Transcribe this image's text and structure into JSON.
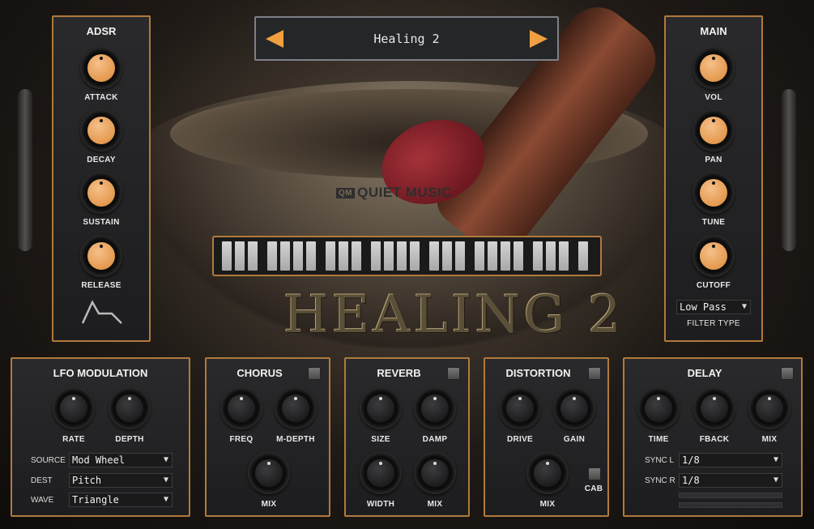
{
  "preset": {
    "name": "Healing 2",
    "prev_icon": "left-triangle-icon",
    "next_icon": "right-triangle-icon"
  },
  "brand": {
    "logo_mark": "QM",
    "logo_text": "QUIET MUSIC",
    "title_art": "HEALING 2"
  },
  "adsr": {
    "title": "ADSR",
    "knobs": [
      "ATTACK",
      "DECAY",
      "SUSTAIN",
      "RELEASE"
    ],
    "envelope_icon": "envelope-shape-icon"
  },
  "main": {
    "title": "MAIN",
    "knobs": [
      "VOL",
      "PAN",
      "TUNE",
      "CUTOFF"
    ],
    "filter_type_label": "FILTER TYPE",
    "filter_type_value": "Low Pass"
  },
  "lfo": {
    "title": "LFO MODULATION",
    "knobs": [
      "RATE",
      "DEPTH"
    ],
    "source_label": "SOURCE",
    "source_value": "Mod Wheel",
    "dest_label": "DEST",
    "dest_value": "Pitch",
    "wave_label": "WAVE",
    "wave_value": "Triangle"
  },
  "chorus": {
    "title": "CHORUS",
    "knobs": [
      "FREQ",
      "M-DEPTH",
      "MIX"
    ]
  },
  "reverb": {
    "title": "REVERB",
    "knobs": [
      "SIZE",
      "DAMP",
      "WIDTH",
      "MIX"
    ]
  },
  "distortion": {
    "title": "DISTORTION",
    "knobs": [
      "DRIVE",
      "GAIN",
      "MIX"
    ],
    "cab_label": "CAB"
  },
  "delay": {
    "title": "DELAY",
    "knobs": [
      "TIME",
      "FBACK",
      "MIX"
    ],
    "sync_l_label": "SYNC L",
    "sync_l_value": "1/8",
    "sync_r_label": "SYNC R",
    "sync_r_value": "1/8"
  },
  "colors": {
    "accent": "#f0a040",
    "panel_border": "#b07a3c",
    "knob_orange": "#e4994f"
  }
}
